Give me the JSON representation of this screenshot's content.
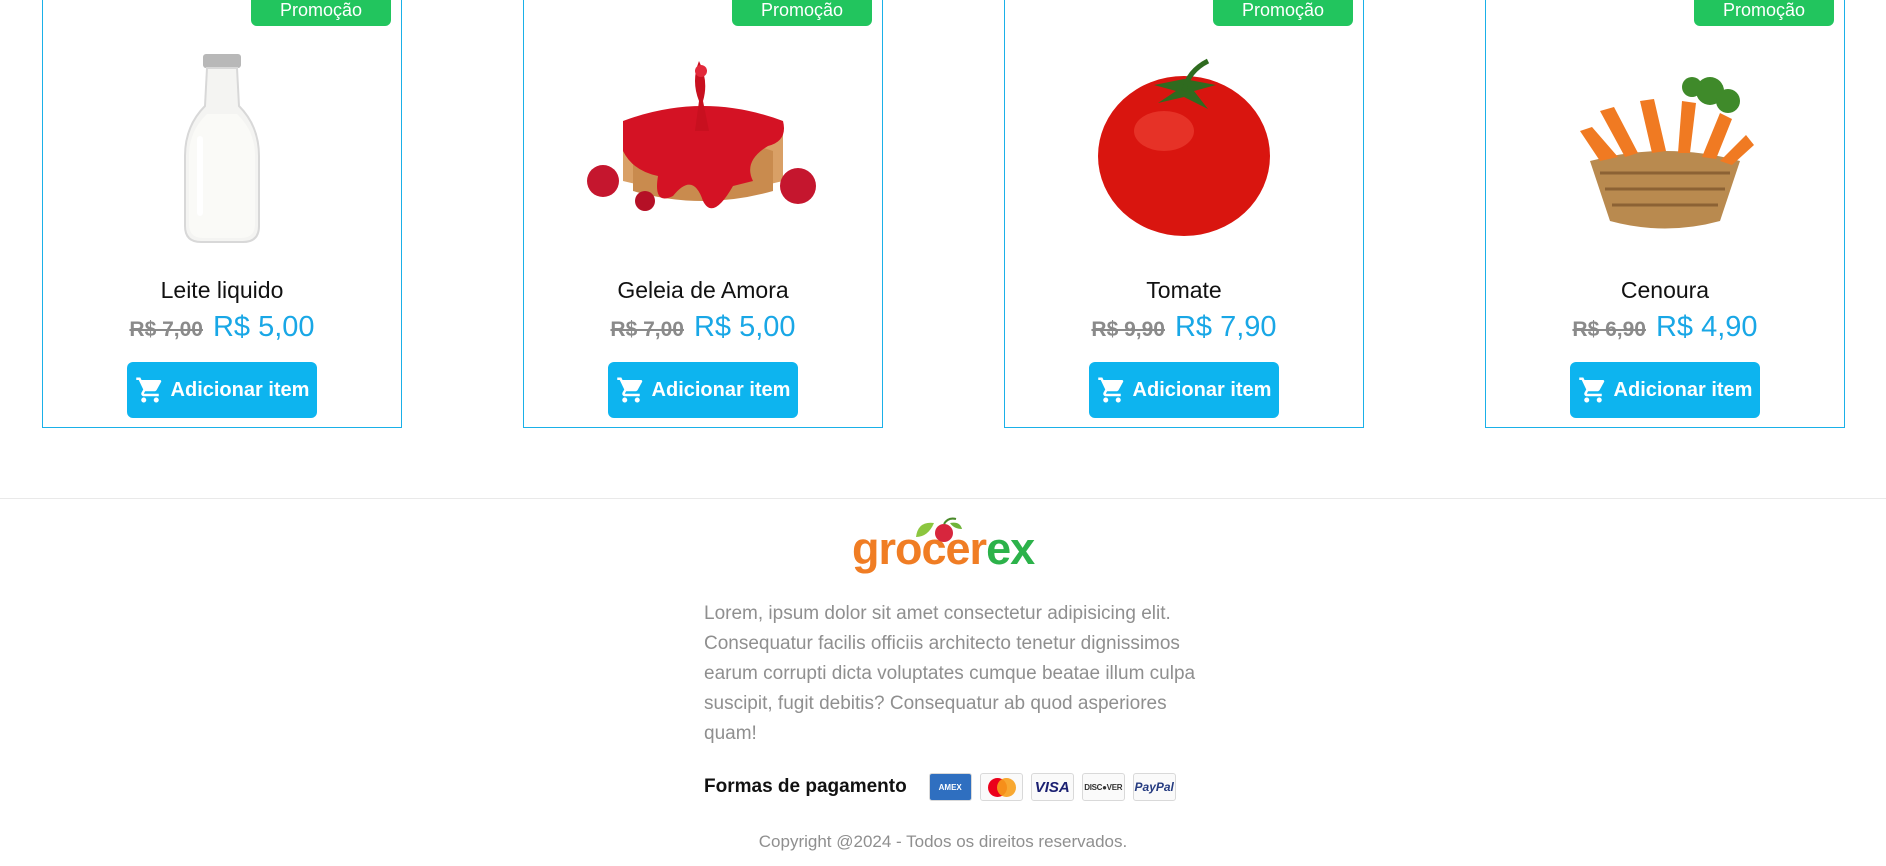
{
  "products": [
    {
      "badge": "Promoção",
      "name": "Leite liquido",
      "old_price": "R$ 7,00",
      "price": "R$ 5,00",
      "button": "Adicionar item",
      "image": "milk-bottle-image"
    },
    {
      "badge": "Promoção",
      "name": "Geleia de Amora",
      "old_price": "R$ 7,00",
      "price": "R$ 5,00",
      "button": "Adicionar item",
      "image": "jam-toast-image"
    },
    {
      "badge": "Promoção",
      "name": "Tomate",
      "old_price": "R$ 9,90",
      "price": "R$ 7,90",
      "button": "Adicionar item",
      "image": "tomato-image"
    },
    {
      "badge": "Promoção",
      "name": "Cenoura",
      "old_price": "R$ 6,90",
      "price": "R$ 4,90",
      "button": "Adicionar item",
      "image": "carrots-basket-image"
    }
  ],
  "footer": {
    "logo": {
      "part1": "grocer",
      "part2": "ex"
    },
    "description": "Lorem, ipsum dolor sit amet consectetur adipisicing elit. Consequatur facilis officiis architecto tenetur dignissimos earum corrupti dicta voluptates cumque beatae illum culpa suscipit, fugit debitis? Consequatur ab quod asperiores quam!",
    "payment_label": "Formas de pagamento",
    "payment_methods": [
      "amex-icon",
      "mastercard-icon",
      "visa-icon",
      "discover-icon",
      "paypal-icon"
    ],
    "copyright": "Copyright @2024 - Todos os direitos reservados."
  },
  "colors": {
    "accent": "#0db4ef",
    "badge": "#22c55e",
    "price": "#19a7e6",
    "logo_orange": "#f07d24",
    "logo_green": "#2cb24a"
  }
}
